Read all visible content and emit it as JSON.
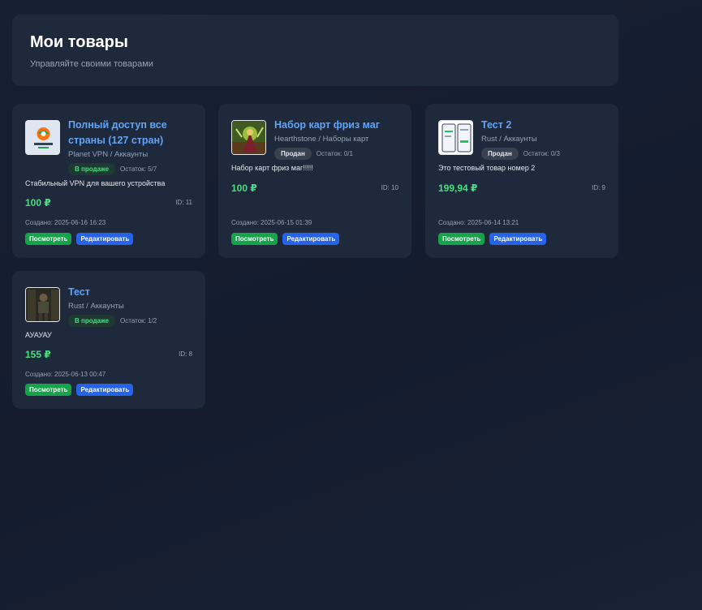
{
  "header": {
    "title": "Мои товары",
    "subtitle": "Управляйте своими товарами"
  },
  "labels": {
    "view": "Посмотреть",
    "edit": "Редактировать"
  },
  "products": [
    {
      "title": "Полный доступ все страны (127 стран)",
      "category": "Planet VPN / Аккаунты",
      "status": "В продаже",
      "stock": "Остаток: 5/7",
      "description": "Стабильный VPN для вашего устройства",
      "price": "100 ₽",
      "id": "ID: 11",
      "created": "Создано: 2025-06-16 16:23"
    },
    {
      "title": "Набор карт фриз маг",
      "category": "Hearthstone / Наборы карт",
      "status": "Продан",
      "stock": "Остаток: 0/1",
      "description": "Набор карт фриз маг!!!!!",
      "price": "100 ₽",
      "id": "ID: 10",
      "created": "Создано: 2025-06-15 01:39"
    },
    {
      "title": "Тест 2",
      "category": "Rust / Аккаунты",
      "status": "Продан",
      "stock": "Остаток: 0/3",
      "description": "Это тестовый товар номер 2",
      "price": "199,94 ₽",
      "id": "ID: 9",
      "created": "Создано: 2025-06-14 13:21"
    },
    {
      "title": "Тест",
      "category": "Rust / Аккаунты",
      "status": "В продаже",
      "stock": "Остаток: 1/2",
      "description": "АУАУАУ",
      "price": "155 ₽",
      "id": "ID: 8",
      "created": "Создано: 2025-06-13 00:47"
    }
  ]
}
